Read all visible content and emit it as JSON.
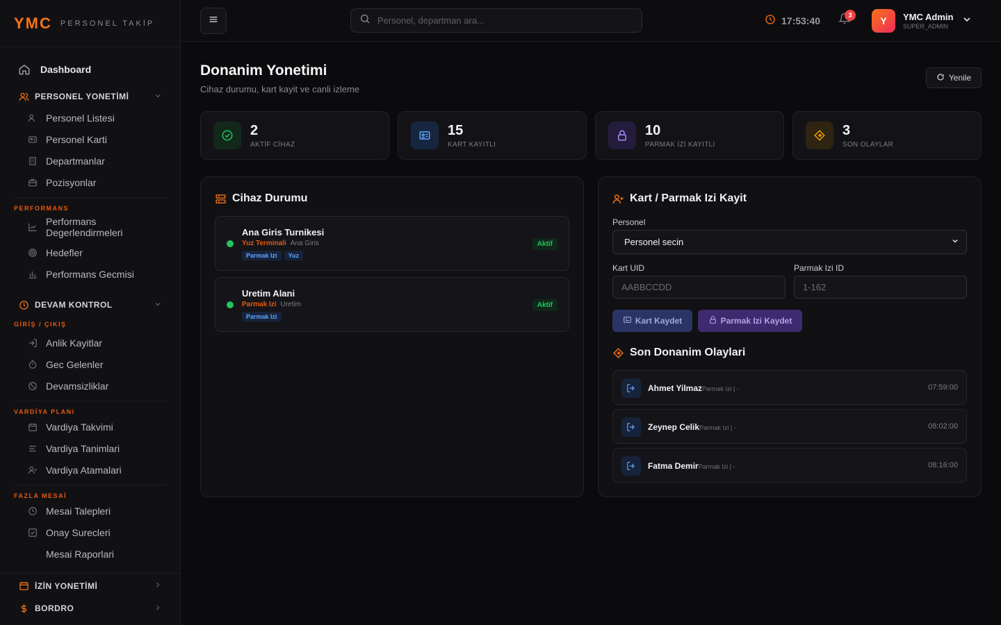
{
  "brand": {
    "logo": "YMC",
    "subtitle": "PERSONEL TAKİP"
  },
  "sidebar": {
    "dashboard": "Dashboard",
    "personel_group": "PERSONEL YONETİMİ",
    "personel_items": [
      "Personel Listesi",
      "Personel Karti",
      "Departmanlar",
      "Pozisyonlar"
    ],
    "performans_label": "PERFORMANS",
    "performans_items": [
      "Performans Degerlendirmeleri",
      "Hedefler",
      "Performans Gecmisi"
    ],
    "devam_group": "DEVAM KONTROL",
    "giris_label": "GİRİŞ / ÇIKIŞ",
    "giris_items": [
      "Anlik Kayitlar",
      "Gec Gelenler",
      "Devamsizliklar"
    ],
    "vardiya_label": "VARDİYA PLANI",
    "vardiya_items": [
      "Vardiya Takvimi",
      "Vardiya Tanimlari",
      "Vardiya Atamalari"
    ],
    "mesai_label": "FAZLA MESAİ",
    "mesai_items": [
      "Mesai Talepleri",
      "Onay Surecleri",
      "Mesai Raporlari"
    ],
    "izin_group": "İZİN YONETİMİ",
    "bordro_group": "BORDRO"
  },
  "header": {
    "search_placeholder": "Personel, departman ara...",
    "clock": "17:53:40",
    "notification_count": "3",
    "user_initial": "Y",
    "user_name": "YMC Admin",
    "user_role": "SUPER_ADMIN"
  },
  "page": {
    "title": "Donanim Yonetimi",
    "subtitle": "Cihaz durumu, kart kayit ve canli izleme",
    "refresh_label": "Yenile"
  },
  "stats": [
    {
      "value": "2",
      "label": "AKTİF CİHAZ",
      "icon": "check-circle-icon",
      "color": "#22c55e"
    },
    {
      "value": "15",
      "label": "KART KAYITLI",
      "icon": "id-card-icon",
      "color": "#60a5fa"
    },
    {
      "value": "10",
      "label": "PARMAK İZİ KAYITLI",
      "icon": "lock-icon",
      "color": "#a78bfa"
    },
    {
      "value": "3",
      "label": "SON OLAYLAR",
      "icon": "diamond-icon",
      "color": "#f59e0b"
    }
  ],
  "devices": {
    "title": "Cihaz Durumu",
    "items": [
      {
        "name": "Ana Giris Turnikesi",
        "type": "Yuz Terminali",
        "location": "Ana Giris",
        "tags": [
          "Parmak Izi",
          "Yuz"
        ],
        "status": "Aktif"
      },
      {
        "name": "Uretim Alani",
        "type": "Parmak Izi",
        "location": "Uretim",
        "tags": [
          "Parmak Izi"
        ],
        "status": "Aktif"
      }
    ]
  },
  "register": {
    "title": "Kart / Parmak Izi Kayit",
    "personel_label": "Personel",
    "personel_value": "Personel secin",
    "kart_uid_label": "Kart UID",
    "kart_uid_placeholder": "AABBCCDD",
    "parmak_label": "Parmak Izi ID",
    "parmak_placeholder": "1-162",
    "kart_button": "Kart Kaydet",
    "parmak_button": "Parmak Izi Kaydet"
  },
  "events": {
    "title": "Son Donanim Olaylari",
    "items": [
      {
        "name": "Ahmet Yilmaz",
        "meta": "Parmak Izi | -",
        "time": "07:59:00"
      },
      {
        "name": "Zeynep Celik",
        "meta": "Parmak Izi | -",
        "time": "08:02:00"
      },
      {
        "name": "Fatma Demir",
        "meta": "Parmak Izi | -",
        "time": "08:16:00"
      }
    ]
  },
  "colors": {
    "accent": "#f97316",
    "success": "#22c55e",
    "info": "#60a5fa",
    "purple": "#a78bfa",
    "warning": "#f59e0b",
    "background": "#0b0b0d"
  }
}
